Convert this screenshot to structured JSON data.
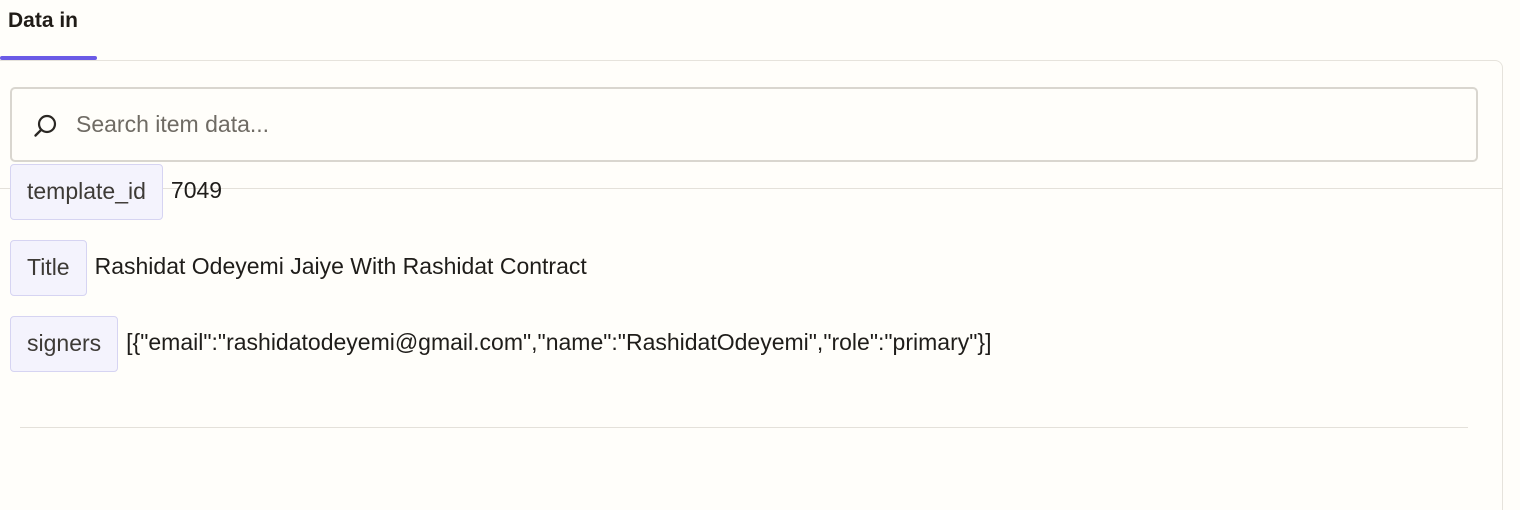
{
  "tabs": [
    {
      "label": "Data in",
      "active": true
    }
  ],
  "search": {
    "placeholder": "Search item data...",
    "value": ""
  },
  "fields": [
    {
      "key": "template_id",
      "value": "7049"
    },
    {
      "key": "Title",
      "value": "Rashidat Odeyemi Jaiye With Rashidat Contract"
    },
    {
      "key": "signers",
      "value": "[{\"email\":\"rashidatodeyemi@gmail.com\",\"name\":\"RashidatOdeyemi\",\"role\":\"primary\"}]"
    }
  ],
  "colors": {
    "accent": "#6b5be6",
    "background": "#fffefa",
    "pill_background": "#f4f3fd",
    "pill_border": "#d6d4f2"
  },
  "icons": {
    "search": "search-icon"
  }
}
